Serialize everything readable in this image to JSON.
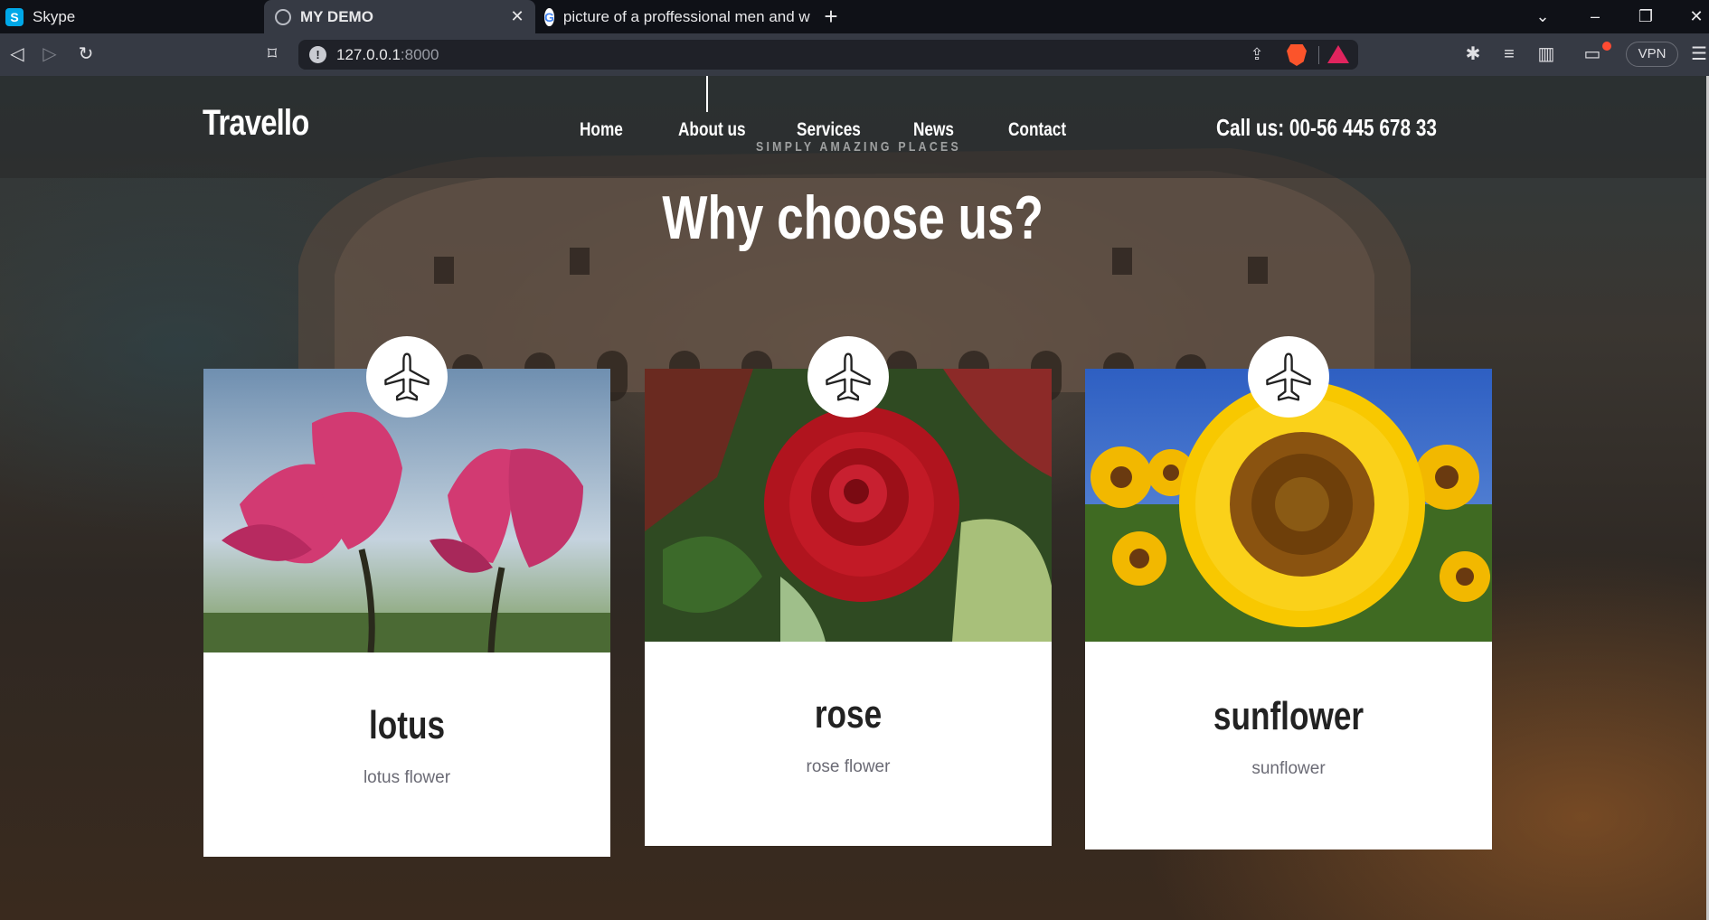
{
  "browser": {
    "tabs": [
      {
        "title": "Skype",
        "favicon": "skype-icon"
      },
      {
        "title": "MY DEMO",
        "favicon": "globe-icon",
        "active": true
      },
      {
        "title": "picture of a proffessional men and wo",
        "favicon": "google-icon"
      }
    ],
    "new_tab_label": "+",
    "close_tab_label": "✕",
    "url_host": "127.0.0.1",
    "url_port": ":8000",
    "vpn_label": "VPN"
  },
  "site": {
    "logo": "Travello",
    "nav": [
      {
        "label": "Home"
      },
      {
        "label": "About us"
      },
      {
        "label": "Services"
      },
      {
        "label": "News"
      },
      {
        "label": "Contact"
      }
    ],
    "tagline": "SIMPLY AMAZING PLACES",
    "callus": "Call us: 00-56 445 678 33",
    "section_title": "Why choose us?",
    "cards": [
      {
        "title": "lotus",
        "description": "lotus flower",
        "image": "lotus-flower-image",
        "badge_icon": "airplane-icon"
      },
      {
        "title": "rose",
        "description": "rose flower",
        "image": "rose-flower-image",
        "badge_icon": "airplane-icon"
      },
      {
        "title": "sunflower",
        "description": "sunflower",
        "image": "sunflower-image",
        "badge_icon": "airplane-icon"
      }
    ]
  },
  "colors": {
    "tabbar": "#0f1117",
    "toolbar": "#363a44",
    "brave": "#fb542b",
    "card": "#ffffff"
  }
}
